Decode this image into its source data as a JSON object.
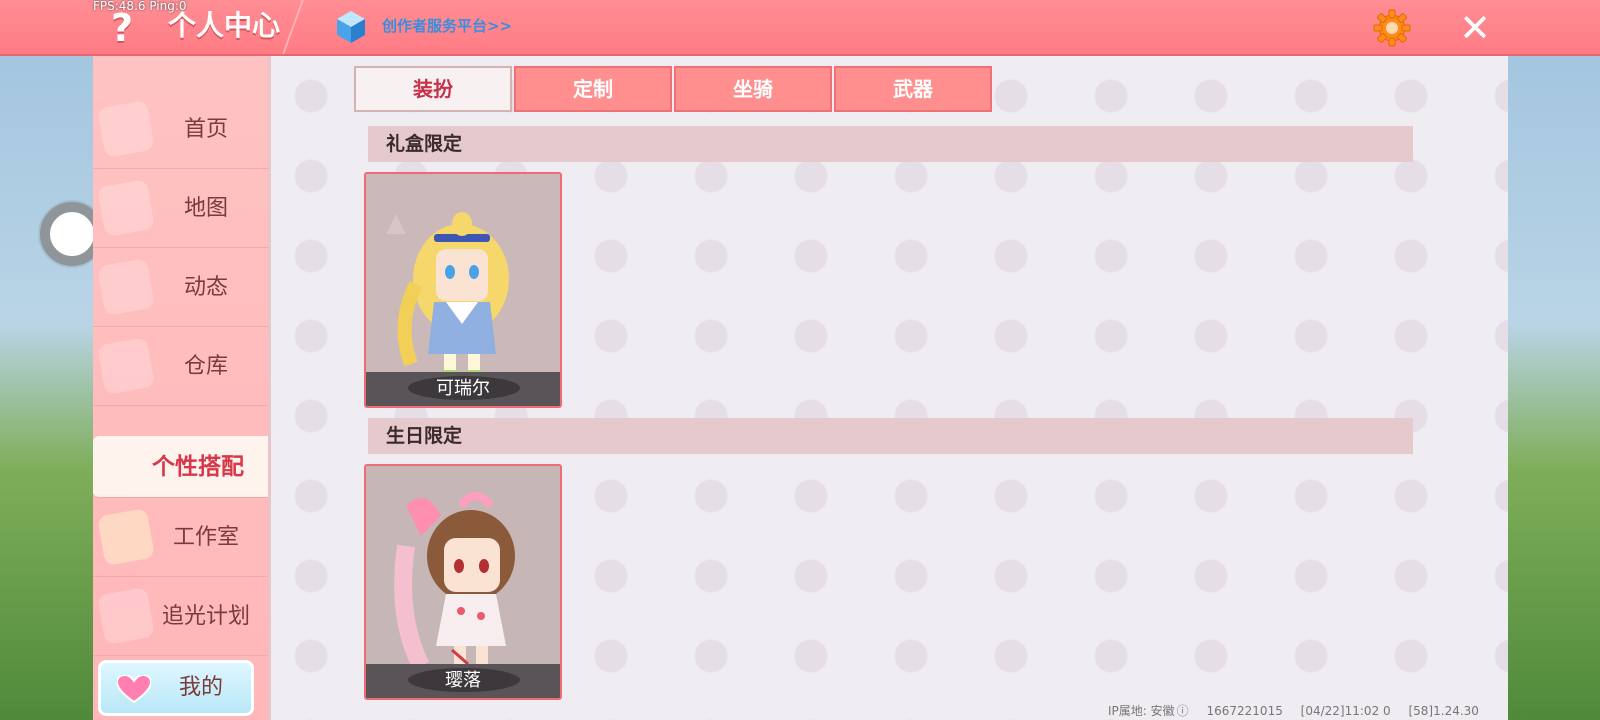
{
  "overlay": {
    "fps": "FPS:48.6  Ping:0"
  },
  "header": {
    "help_icon": "question-mark",
    "title": "个人中心",
    "creator_link": "创作者服务平台>>",
    "settings_icon": "gear-icon",
    "close_icon": "close-icon"
  },
  "sidebar": {
    "items": [
      {
        "label": "首页",
        "active": false
      },
      {
        "label": "地图",
        "active": false
      },
      {
        "label": "动态",
        "active": false
      },
      {
        "label": "仓库",
        "active": false
      },
      {
        "label": "个性搭配",
        "active": true
      },
      {
        "label": "工作室",
        "active": false
      },
      {
        "label": "追光计划",
        "active": false
      }
    ],
    "mine": {
      "label": "我的",
      "icon": "heart-icon"
    }
  },
  "tabs": [
    {
      "label": "装扮",
      "active": true
    },
    {
      "label": "定制",
      "active": false
    },
    {
      "label": "坐骑",
      "active": false
    },
    {
      "label": "武器",
      "active": false
    }
  ],
  "sections": [
    {
      "title": "礼盒限定",
      "items": [
        {
          "name": "可瑞尔"
        }
      ]
    },
    {
      "title": "生日限定",
      "items": [
        {
          "name": "璎落"
        }
      ]
    }
  ],
  "footer": {
    "ip_location": "IP属地: 安徽",
    "uid": "1667221015",
    "timestamp": "[04/22]11:02 0",
    "version": "[58]1.24.30"
  },
  "colors": {
    "header_bg": "#ff7b84",
    "sidebar_bg": "#ffb7b9",
    "tab_bg": "#ff8e8e",
    "active_text": "#c8304a",
    "link_blue": "#3c8dde"
  }
}
